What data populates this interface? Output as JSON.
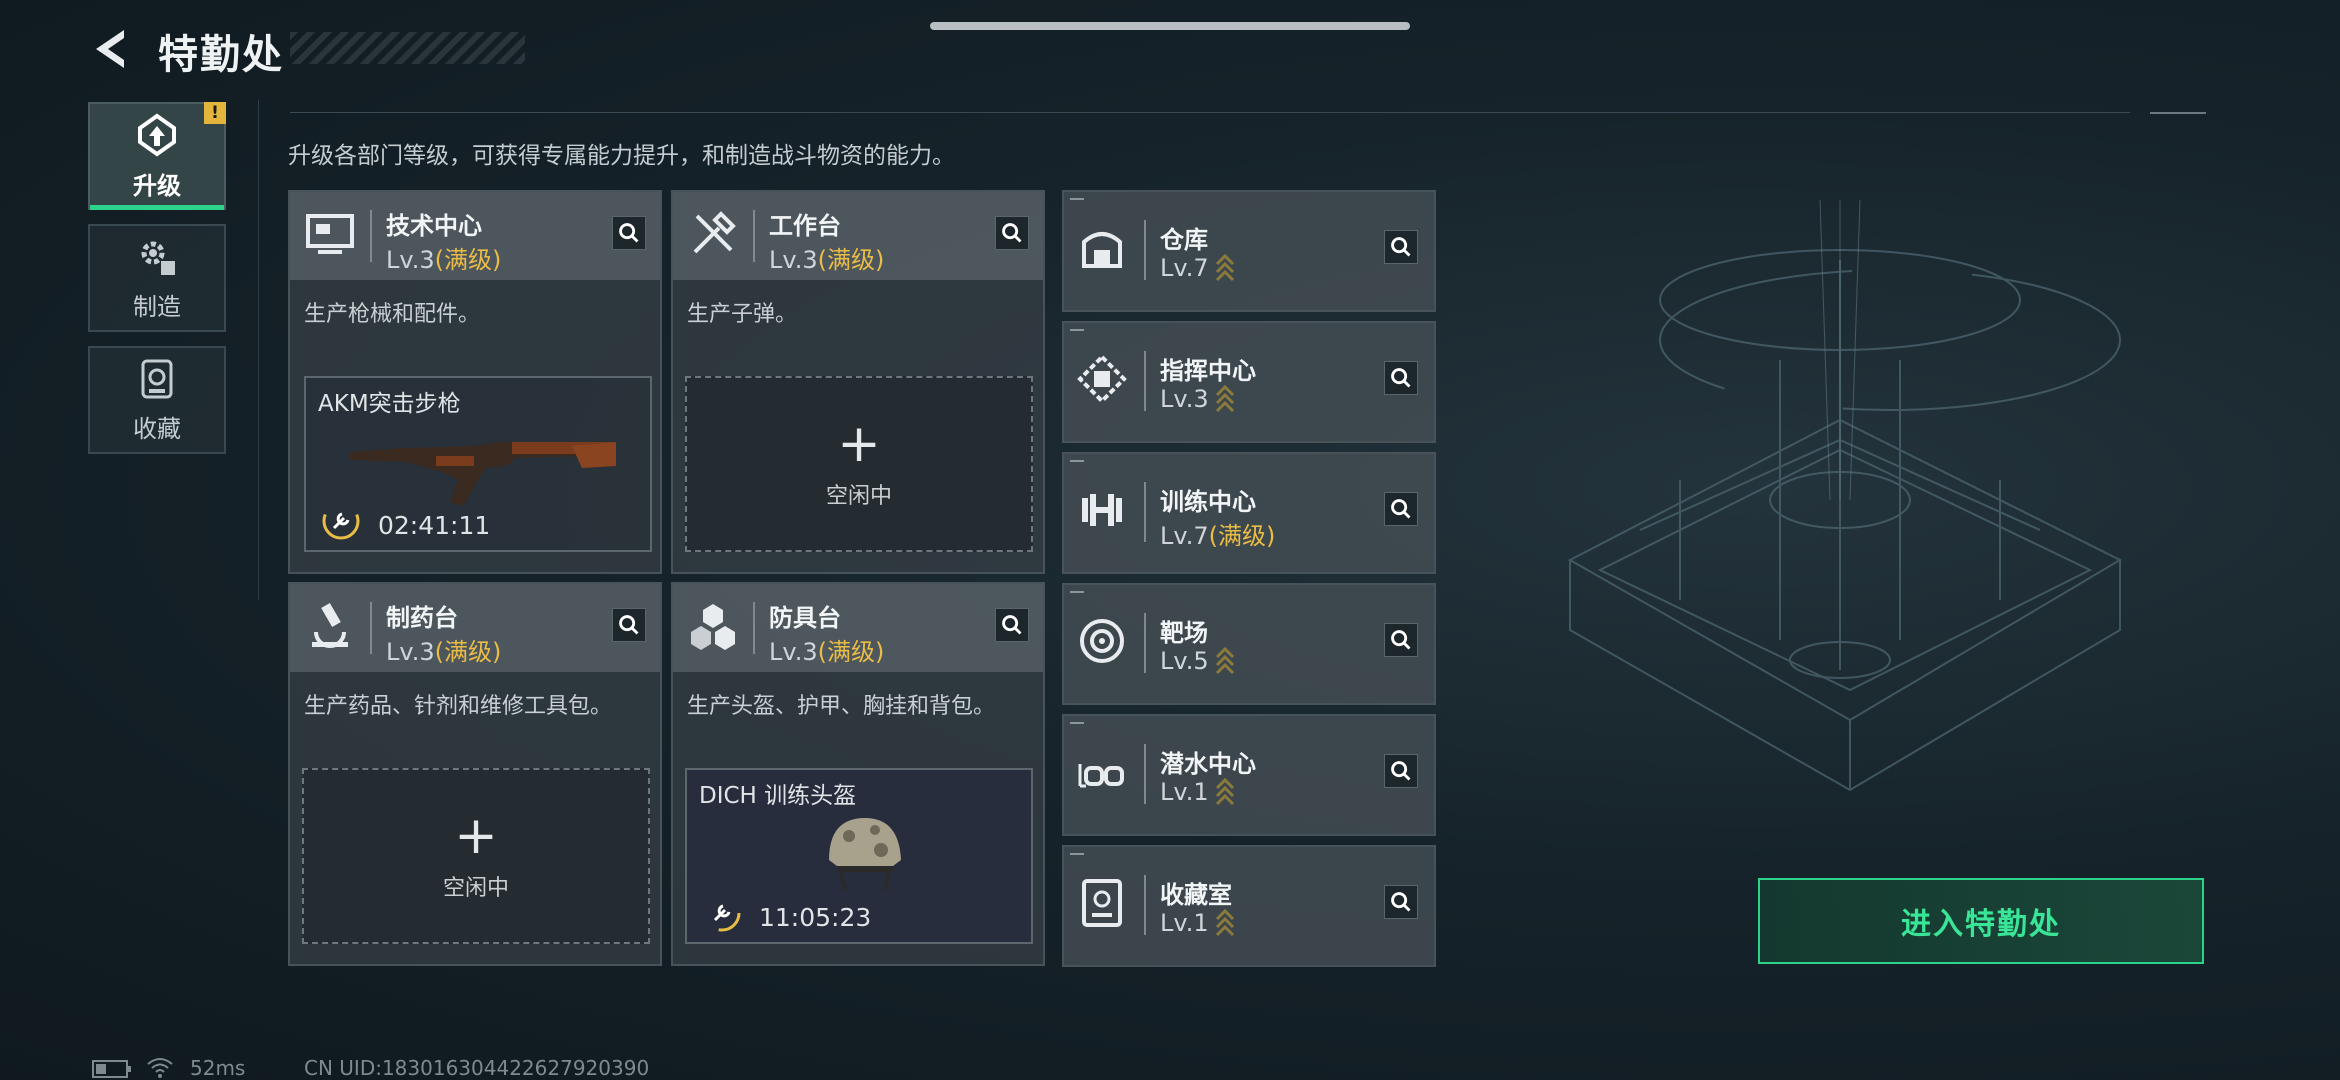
{
  "header": {
    "title": "特勤处"
  },
  "nav": [
    {
      "label": "升级",
      "icon": "upgrade-icon",
      "active": true,
      "alert": "!"
    },
    {
      "label": "制造",
      "icon": "craft-gear-icon",
      "active": false
    },
    {
      "label": "收藏",
      "icon": "collection-icon",
      "active": false
    }
  ],
  "description": "升级各部门等级，可获得专属能力提升，和制造战斗物资的能力。",
  "workshops": [
    {
      "name": "技术中心",
      "level": "Lv.3",
      "max": "(满级)",
      "desc": "生产枪械和配件。",
      "icon": "tech-center-icon",
      "slot": {
        "state": "busy",
        "item": "AKM突击步枪",
        "timer": "02:41:11"
      }
    },
    {
      "name": "工作台",
      "level": "Lv.3",
      "max": "(满级)",
      "desc": "生产子弹。",
      "icon": "workbench-tools-icon",
      "slot": {
        "state": "idle",
        "plus": "+",
        "idle_label": "空闲中"
      }
    },
    {
      "name": "制药台",
      "level": "Lv.3",
      "max": "(满级)",
      "desc": "生产药品、针剂和维修工具包。",
      "icon": "microscope-icon",
      "slot": {
        "state": "idle",
        "plus": "+",
        "idle_label": "空闲中"
      }
    },
    {
      "name": "防具台",
      "level": "Lv.3",
      "max": "(满级)",
      "desc": "生产头盔、护甲、胸挂和背包。",
      "icon": "armor-boxes-icon",
      "slot": {
        "state": "busy",
        "item": "DICH 训练头盔",
        "timer": "11:05:23"
      }
    }
  ],
  "departments": [
    {
      "name": "仓库",
      "level": "Lv.7",
      "max": "",
      "upgradable": true,
      "icon": "warehouse-icon"
    },
    {
      "name": "指挥中心",
      "level": "Lv.3",
      "max": "",
      "upgradable": true,
      "icon": "command-center-icon"
    },
    {
      "name": "训练中心",
      "level": "Lv.7",
      "max": "(满级)",
      "upgradable": false,
      "icon": "dumbbell-icon"
    },
    {
      "name": "靶场",
      "level": "Lv.5",
      "max": "",
      "upgradable": true,
      "icon": "target-icon"
    },
    {
      "name": "潜水中心",
      "level": "Lv.1",
      "max": "",
      "upgradable": true,
      "icon": "diving-goggles-icon"
    },
    {
      "name": "收藏室",
      "level": "Lv.1",
      "max": "",
      "upgradable": true,
      "icon": "collection-room-icon"
    }
  ],
  "enter_button": "进入特勤处",
  "status_bar": {
    "ping": "52ms",
    "uid": "CN UID:1830163044226279203​90"
  },
  "colors": {
    "accent_green": "#2ed38b",
    "max_gold": "#e9bd45",
    "alert_yellow": "#e3b53c"
  }
}
